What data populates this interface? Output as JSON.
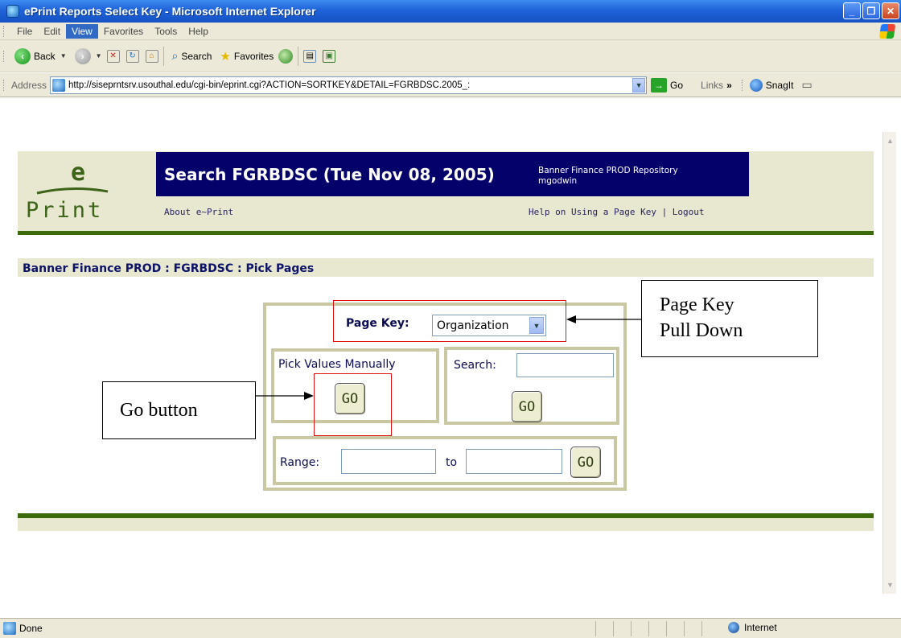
{
  "window": {
    "title": "ePrint Reports Select Key - Microsoft Internet Explorer",
    "minimize": "_",
    "maximize": "❐",
    "close": "✕"
  },
  "menu": {
    "items": [
      {
        "label": "File"
      },
      {
        "label": "Edit"
      },
      {
        "label": "View"
      },
      {
        "label": "Favorites"
      },
      {
        "label": "Tools"
      },
      {
        "label": "Help"
      }
    ]
  },
  "toolbar": {
    "back_label": "Back",
    "search_label": "Search",
    "favorites_label": "Favorites"
  },
  "address": {
    "label": "Address",
    "url": "http://siseprntsrv.usouthal.edu/cgi-bin/eprint.cgi?ACTION=SORTKEY&DETAIL=FGRBDSC.2005_:",
    "go_label": "Go",
    "links_label": "Links",
    "chevron": "»",
    "snagit_label": "SnagIt"
  },
  "page": {
    "logo_e": "e",
    "logo_print": "Print",
    "search_title": "Search FGRBDSC (Tue Nov 08, 2005)",
    "repository": "Banner Finance PROD Repository",
    "user": "mgodwin",
    "about_link": "About e~Print",
    "help_links": "Help on Using a Page Key | Logout",
    "breadcrumb": "Banner Finance PROD : FGRBDSC : Pick Pages"
  },
  "pick": {
    "page_key_label": "Page Key:",
    "page_key_value": "Organization",
    "manual_label": "Pick Values Manually",
    "search_label": "Search:",
    "search_value": "",
    "range_label": "Range:",
    "to_label": "to",
    "range_from": "",
    "range_to": "",
    "go_label": "GO"
  },
  "annotations": {
    "page_key_callout_line1": "Page Key",
    "page_key_callout_line2": "Pull Down",
    "go_callout": "Go button",
    "frame_color": "#e01010"
  },
  "status": {
    "text": "Done",
    "zone": "Internet"
  },
  "colors": {
    "title_blue": "#05016b",
    "olive_band": "#e7e8cf",
    "dark_green": "#3d6b0b",
    "panel_border": "#c9c8a3"
  }
}
